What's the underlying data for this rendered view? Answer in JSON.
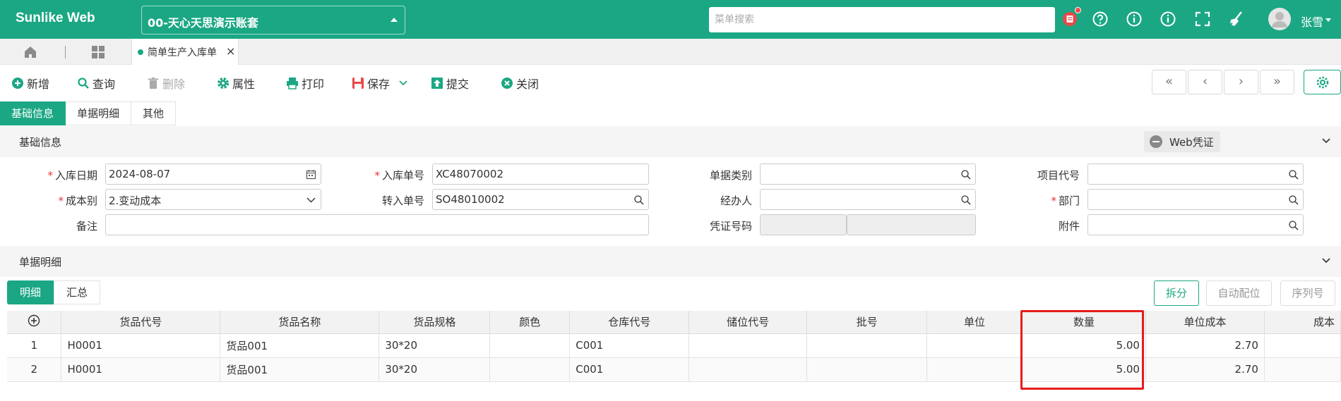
{
  "header": {
    "logo": "Sunlike Web",
    "account": "00-天心天思演示账套",
    "search_placeholder": "菜单搜索",
    "username": "张雪",
    "colors": {
      "brand": "#1ba784",
      "highlight": "#e61c1c"
    }
  },
  "tabs": {
    "open_tab": "简单生产入库单",
    "close": "×"
  },
  "toolbar": {
    "new": "新增",
    "query": "查询",
    "delete": "删除",
    "properties": "属性",
    "print": "打印",
    "save": "保存",
    "submit": "提交",
    "close": "关闭"
  },
  "pager": {
    "first": "«",
    "prev": "‹",
    "next": "›",
    "last": "»"
  },
  "section_tabs": [
    "基础信息",
    "单据明细",
    "其他"
  ],
  "basic": {
    "title": "基础信息",
    "web_cert": "Web凭证",
    "fields": {
      "in_date_label": "入库日期",
      "in_date": "2024-08-07",
      "in_no_label": "入库单号",
      "in_no": "XC48070002",
      "doc_type_label": "单据类别",
      "doc_type": "",
      "project_label": "项目代号",
      "project": "",
      "cost_label": "成本别",
      "cost": "2.变动成本",
      "transfer_label": "转入单号",
      "transfer": "SO48010002",
      "handler_label": "经办人",
      "handler": "",
      "dept_label": "部门",
      "dept": "",
      "remark_label": "备注",
      "remark": "",
      "voucher_label": "凭证号码",
      "voucher_a": "",
      "voucher_b": "",
      "attachment_label": "附件",
      "attachment": ""
    }
  },
  "detail": {
    "title": "单据明细",
    "subtabs": [
      "明细",
      "汇总"
    ],
    "buttons": {
      "split": "拆分",
      "auto_locate": "自动配位",
      "serial": "序列号"
    },
    "columns": [
      "货品代号",
      "货品名称",
      "货品规格",
      "颜色",
      "仓库代号",
      "储位代号",
      "批号",
      "单位",
      "数量",
      "单位成本",
      "成本"
    ],
    "rows": [
      {
        "idx": "1",
        "code": "H0001",
        "name": "货品001",
        "spec": "30*20",
        "color": "",
        "wh": "C001",
        "loc": "",
        "batch": "",
        "unit": "",
        "qty": "5.00",
        "unit_cost": "2.70",
        "cost": ""
      },
      {
        "idx": "2",
        "code": "H0001",
        "name": "货品001",
        "spec": "30*20",
        "color": "",
        "wh": "C001",
        "loc": "",
        "batch": "",
        "unit": "",
        "qty": "5.00",
        "unit_cost": "2.70",
        "cost": ""
      }
    ]
  }
}
